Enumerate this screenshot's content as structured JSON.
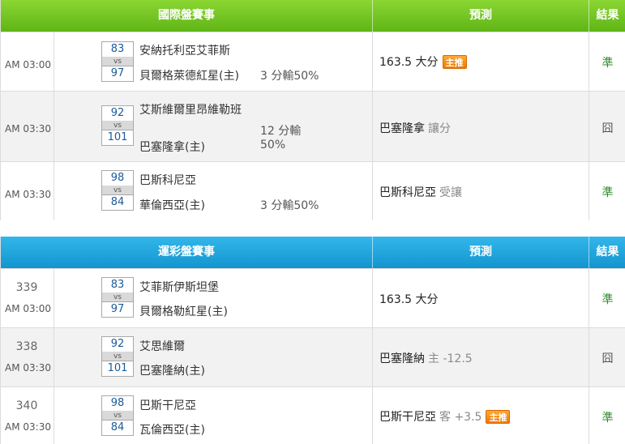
{
  "intl": {
    "header": {
      "match": "國際盤賽事",
      "prediction": "預測",
      "result": "結果"
    },
    "rows": [
      {
        "time": "AM 03:00",
        "away_score": "83",
        "vs": "vs",
        "home_score": "97",
        "away_team": "安納托利亞艾菲斯",
        "home_team": "貝爾格萊德紅星(主)",
        "spread_line1": "3 分輸50%",
        "spread_line2": "",
        "pick": "163.5 大分",
        "pick_detail": "",
        "badge": "主推",
        "result": "準"
      },
      {
        "time": "AM 03:30",
        "away_score": "92",
        "vs": "vs",
        "home_score": "101",
        "away_team": "艾斯維爾里昂維勒班",
        "home_team": "巴塞隆拿(主)",
        "spread_line1": "12 分輸",
        "spread_line2": "50%",
        "pick": "巴塞隆拿",
        "pick_detail": "讓分",
        "badge": "",
        "result": "囧"
      },
      {
        "time": "AM 03:30",
        "away_score": "98",
        "vs": "vs",
        "home_score": "84",
        "away_team": "巴斯科尼亞",
        "home_team": "華倫西亞(主)",
        "spread_line1": "3 分輸50%",
        "spread_line2": "",
        "pick": "巴斯科尼亞",
        "pick_detail": "受讓",
        "badge": "",
        "result": "準"
      }
    ]
  },
  "sports": {
    "header": {
      "match": "運彩盤賽事",
      "prediction": "預測",
      "result": "結果"
    },
    "rows": [
      {
        "number": "339",
        "time": "AM 03:00",
        "away_score": "83",
        "vs": "vs",
        "home_score": "97",
        "away_team": "艾菲斯伊斯坦堡",
        "home_team": "貝爾格勒紅星(主)",
        "pick": "163.5 大分",
        "pick_detail": "",
        "badge": "",
        "result": "準"
      },
      {
        "number": "338",
        "time": "AM 03:30",
        "away_score": "92",
        "vs": "vs",
        "home_score": "101",
        "away_team": "艾思維爾",
        "home_team": "巴塞隆納(主)",
        "pick": "巴塞隆納",
        "pick_detail": "主 -12.5",
        "badge": "",
        "result": "囧"
      },
      {
        "number": "340",
        "time": "AM 03:30",
        "away_score": "98",
        "vs": "vs",
        "home_score": "84",
        "away_team": "巴斯干尼亞",
        "home_team": "瓦倫西亞(主)",
        "pick": "巴斯干尼亞",
        "pick_detail": "客 +3.5",
        "badge": "主推",
        "result": "準"
      }
    ]
  },
  "colors": {
    "intl_header": "#6cc41f",
    "sports_header": "#1ea5dd",
    "badge": "#f08a10",
    "result_correct": "#2e8b2e",
    "score_text": "#1a5a9c"
  }
}
